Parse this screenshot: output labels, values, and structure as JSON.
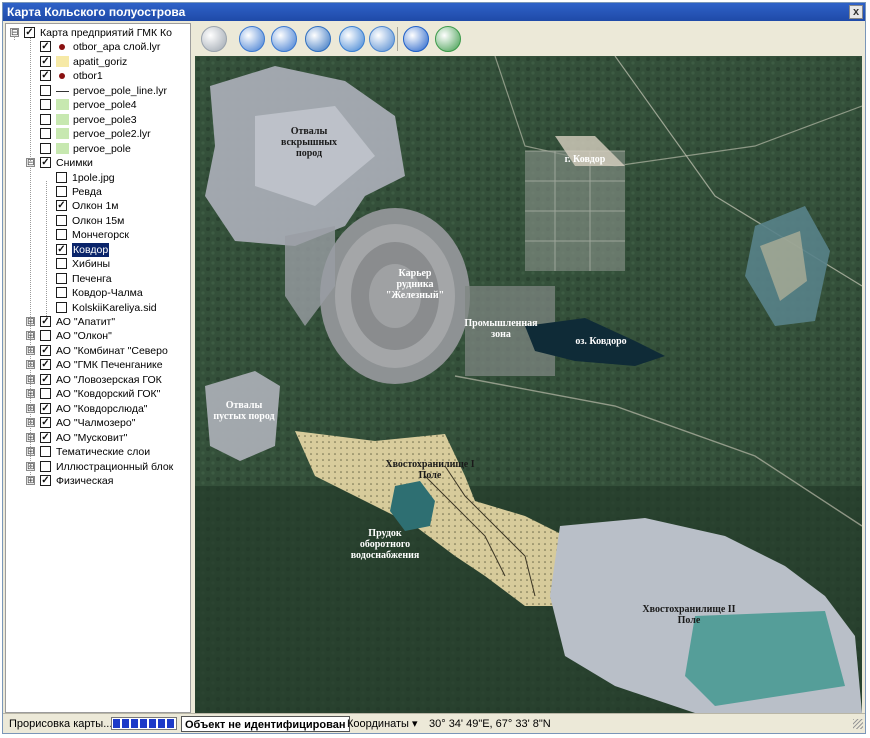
{
  "window": {
    "title": "Карта Кольского полуострова",
    "close_label": "x"
  },
  "layers": {
    "root": {
      "label": "Карта предприятий ГМК Ко",
      "expander": "⊟",
      "checked": true
    },
    "items": [
      {
        "label": "otbor_apa слой.lyr",
        "checked": true,
        "symbol": "dot",
        "color": "#8a1010"
      },
      {
        "label": "apatit_goriz",
        "checked": true,
        "symbol": "fill",
        "color": "#f6e9a6"
      },
      {
        "label": "otbor1",
        "checked": true,
        "symbol": "dot",
        "color": "#8a1010"
      },
      {
        "label": "pervoe_pole_line.lyr",
        "checked": false,
        "symbol": "line",
        "color": "#333333"
      },
      {
        "label": "pervoe_pole4",
        "checked": false,
        "symbol": "fill",
        "color": "#c7e8b0"
      },
      {
        "label": "pervoe_pole3",
        "checked": false,
        "symbol": "fill",
        "color": "#c7e8b0"
      },
      {
        "label": "pervoe_pole2.lyr",
        "checked": false,
        "symbol": "fill",
        "color": "#c7e8b0"
      },
      {
        "label": "pervoe_pole",
        "checked": false,
        "symbol": "fill",
        "color": "#c7e8b0"
      }
    ],
    "snapshots": {
      "label": "Снимки",
      "checked": true,
      "expander": "⊟",
      "items": [
        {
          "label": "1pole.jpg",
          "checked": false,
          "selected": false
        },
        {
          "label": "Ревда",
          "checked": false,
          "selected": false
        },
        {
          "label": "Олкон 1м",
          "checked": true,
          "selected": false
        },
        {
          "label": "Олкон 15м",
          "checked": false,
          "selected": false
        },
        {
          "label": "Мончегорск",
          "checked": false,
          "selected": false
        },
        {
          "label": "Ковдор",
          "checked": true,
          "selected": true
        },
        {
          "label": "Хибины",
          "checked": false,
          "selected": false
        },
        {
          "label": "Печенга",
          "checked": false,
          "selected": false
        },
        {
          "label": "Ковдор-Чалма",
          "checked": false,
          "selected": false
        },
        {
          "label": "KolskiiKareliya.sid",
          "checked": false,
          "selected": false
        }
      ]
    },
    "groups": [
      {
        "label": "АО \"Апатит\"",
        "checked": true,
        "expander": "⊞"
      },
      {
        "label": "АО \"Олкон\"",
        "checked": false,
        "expander": "⊞"
      },
      {
        "label": "АО \"Комбинат \"Северо",
        "checked": true,
        "expander": "⊞"
      },
      {
        "label": "АО \"ГМК Печенганике",
        "checked": true,
        "expander": "⊞"
      },
      {
        "label": "АО \"Ловозерская ГОК",
        "checked": true,
        "expander": "⊞"
      },
      {
        "label": "АО \"Ковдорский ГОК\"",
        "checked": false,
        "expander": "⊞"
      },
      {
        "label": "АО \"Ковдорслюда\"",
        "checked": true,
        "expander": "⊞"
      },
      {
        "label": "АО \"Чалмозеро\"",
        "checked": true,
        "expander": "⊞"
      },
      {
        "label": "АО \"Мусковит\"",
        "checked": true,
        "expander": "⊞"
      },
      {
        "label": "Тематические слои",
        "checked": false,
        "expander": "⊞"
      },
      {
        "label": "Иллюстрационный блок",
        "checked": false,
        "expander": "⊞"
      },
      {
        "label": "Физическая",
        "checked": true,
        "expander": "⊞"
      }
    ]
  },
  "toolbar": {
    "tools": [
      {
        "icon": "pan-icon",
        "color": "#9aa3ad"
      },
      {
        "icon": "zoom-in-icon",
        "color": "#3b78d0"
      },
      {
        "icon": "zoom-out-icon",
        "color": "#3b78d0"
      },
      {
        "icon": "full-extent-icon",
        "color": "#2f6fbf"
      },
      {
        "icon": "globe-icon",
        "color": "#3a80d2"
      },
      {
        "icon": "find-icon",
        "color": "#4c86cf"
      },
      {
        "icon": "identify-icon",
        "color": "#1f5fc8"
      },
      {
        "icon": "refresh-icon",
        "color": "#3c9a4a"
      }
    ]
  },
  "map": {
    "labels": {
      "overburden": "Отвалы вскрышных пород",
      "town": "г. Ковдор",
      "quarry": "Карьер рудника \"Железный\"",
      "industrial": "Промышленная зона",
      "lake": "оз. Ковдоро",
      "waste": "Отвалы пустых пород",
      "tailings1": "Хвостохранилище I Поле",
      "pond": "Прудок оборотного водоснабжения",
      "tailings2": "Хвостохранилище II Поле"
    }
  },
  "status": {
    "rendering": "Прорисовка карты...",
    "progress_filled": 7,
    "identify": "Объект не идентифицирован",
    "coords_label": "Координаты",
    "coords_value": "30° 34' 49\"E,  67° 33' 8\"N"
  },
  "colors": {
    "title_bar": "#1f4aa8",
    "selection": "#0a246a",
    "progress": "#1c3ac8"
  }
}
